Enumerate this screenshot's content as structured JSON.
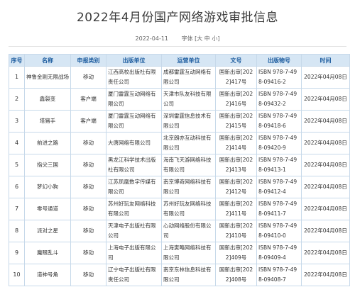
{
  "header": {
    "title": "2022年4月份国产网络游戏审批信息",
    "date": "2022-04-11",
    "font_label": "字体",
    "font_open": "[",
    "font_large": "大",
    "font_medium": "中",
    "font_small": "小",
    "font_close": "]"
  },
  "table": {
    "columns": [
      "序号",
      "名称",
      "申报类别",
      "出版单位",
      "运营单位",
      "文号",
      "出版物号",
      "时间"
    ],
    "rows": [
      [
        "1",
        "神鲁金刚无限战场",
        "移动",
        "江西高校出版社有限责任公司",
        "成都雷霆互动网络有限公司",
        "国新出审[2022]417号",
        "ISBN 978-7-498-09416-2",
        "2022年04月08日"
      ],
      [
        "2",
        "鑫裂变",
        "客户端",
        "厦门雷霆互动网络有限公司",
        "天津市队友科技有限公司",
        "国新出审[2022]416号",
        "ISBN 978-7-498-09432-2",
        "2022年04月08日"
      ],
      [
        "3",
        "塔猪手",
        "客户端",
        "厦门雷霆互动网络有限公司",
        "深圳雷霆信息技术有限公司",
        "国新出审[2022]415号",
        "ISBN 978-7-498-09418-6",
        "2022年04月08日"
      ],
      [
        "4",
        "前进之路",
        "移动",
        "大唐网络有限公司",
        "北京朗亦互动科技有限公司",
        "国新出审[2022]414号",
        "ISBN 978-7-498-09420-9",
        "2022年04月08日"
      ],
      [
        "5",
        "指尖三国",
        "移动",
        "黑龙江科学技术出版社有限公司",
        "海南飞天游网络科技有限公司",
        "国新出审[2022]413号",
        "ISBN 978-7-498-09413-1",
        "2022年04月08日"
      ],
      [
        "6",
        "梦幻小狗",
        "移动",
        "江苏凤凰数字传媒有限公司",
        "南京博奇网络科技有限公司",
        "国新出审[2022]412号",
        "ISBN 978-7-498-09412-4",
        "2022年04月08日"
      ],
      [
        "7",
        "零号通道",
        "移动",
        "苏州好玩友网络科技有限公司",
        "苏州好玩友网络科技有限公司",
        "国新出审[2022]411号",
        "ISBN 978-7-498-09411-7",
        "2022年04月08日"
      ],
      [
        "8",
        "派对之星",
        "移动",
        "天津电子出版社有限公司",
        "心动网络股份有限公司",
        "国新出审[2022]410号",
        "ISBN 978-7-498-09410-0",
        "2022年04月08日"
      ],
      [
        "9",
        "魔眼乱斗",
        "移动",
        "上海电子出版有限公司",
        "上海寅略网络科技有限公司",
        "国新出审[2022]409号",
        "ISBN 978-7-498-09409-4",
        "2022年04月08日"
      ],
      [
        "10",
        "道神号角",
        "移动",
        "辽宁电子出版社有限责任公司",
        "南京东林信息科技有限公司",
        "国新出审[2022]408号",
        "ISBN 978-7-498-09408-7",
        "2022年04月08日"
      ]
    ]
  }
}
